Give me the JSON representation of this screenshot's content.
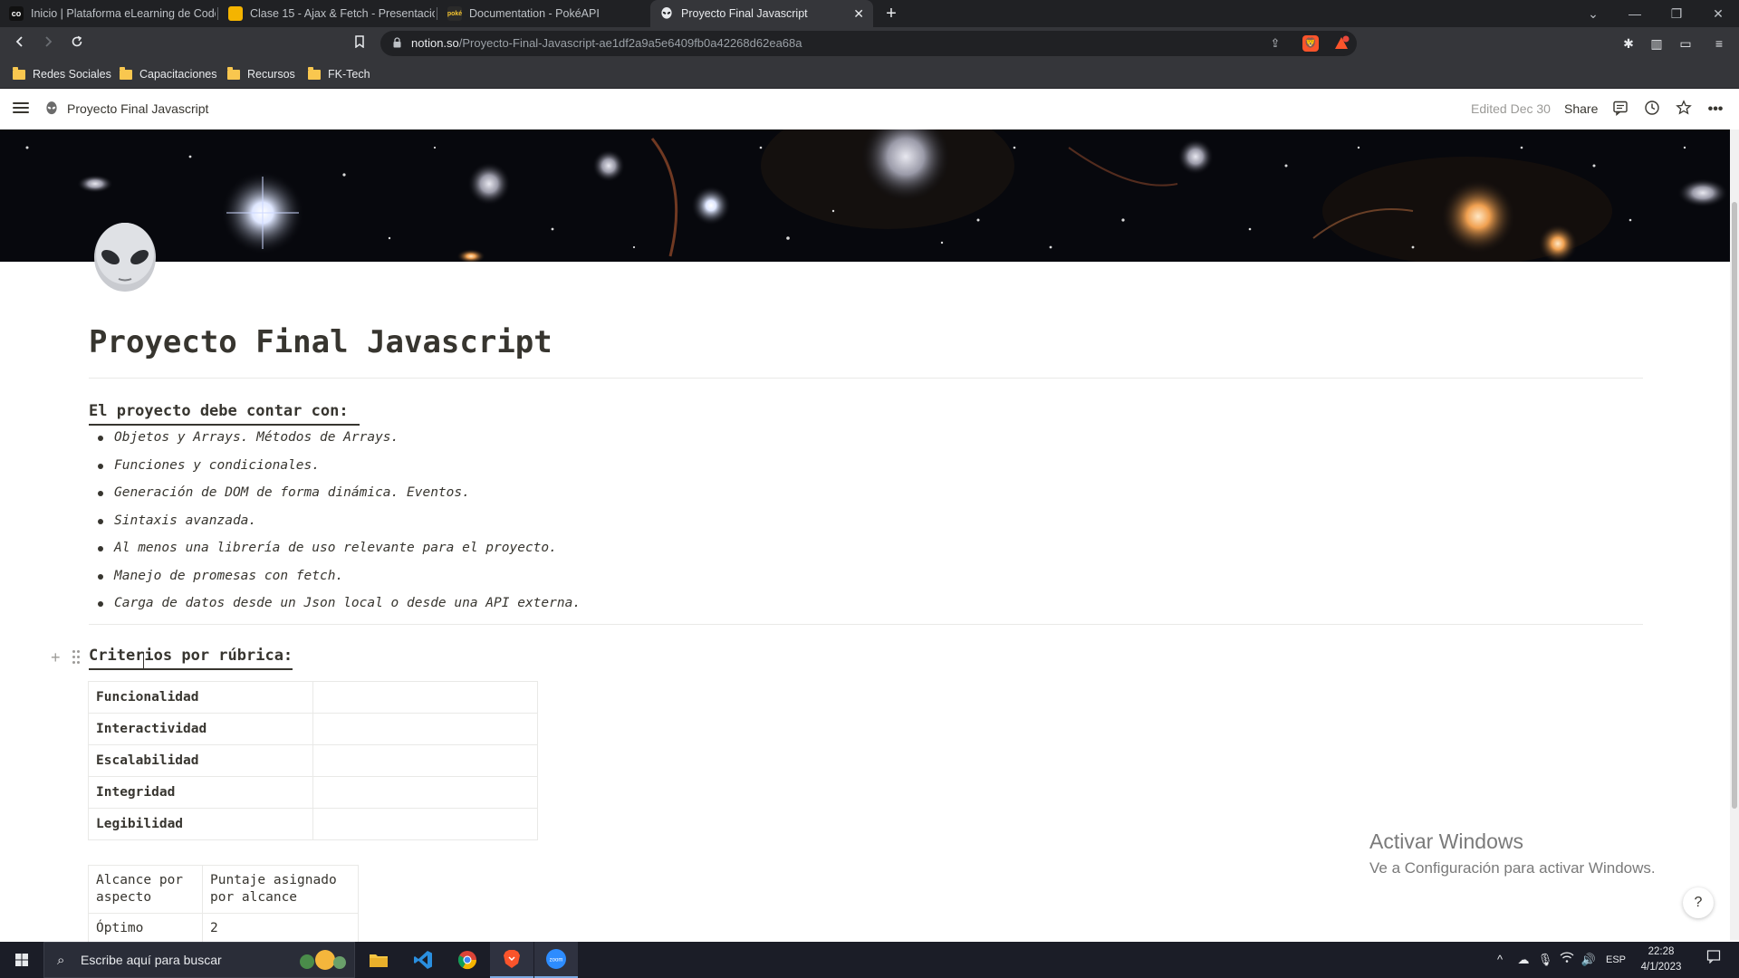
{
  "browser": {
    "tabs": [
      {
        "title": "Inicio | Plataforma eLearning de Coder",
        "favicon": "coder-icon",
        "color": "#111111"
      },
      {
        "title": "Clase 15 - Ajax & Fetch - Presentaciones",
        "favicon": "slides-icon",
        "color": "#f4b400"
      },
      {
        "title": "Documentation - PokéAPI",
        "favicon": "pokeapi-icon",
        "color": "#2a2a2a"
      },
      {
        "title": "Proyecto Final Javascript",
        "favicon": "notion-alien-icon",
        "color": "#35363a"
      }
    ],
    "url_host": "notion.so",
    "url_path": "/Proyecto-Final-Javascript-ae1df2a9a5e6409fb0a42268d62ea68a",
    "bookmarks": [
      "Redes Sociales",
      "Capacitaciones",
      "Recursos",
      "FK-Tech"
    ]
  },
  "notion": {
    "breadcrumb": "Proyecto Final Javascript",
    "edited": "Edited Dec 30",
    "share": "Share"
  },
  "page": {
    "title": "Proyecto Final Javascript",
    "requirements_heading": "El proyecto debe contar con:",
    "requirements": [
      "Objetos y Arrays. Métodos de Arrays.",
      "Funciones y condicionales.",
      "Generación de DOM de forma dinámica. Eventos.",
      "Sintaxis avanzada.",
      "Al menos una librería de uso relevante para el proyecto.",
      "Manejo de promesas con fetch.",
      "Carga de datos desde un Json local o desde una API externa."
    ],
    "criteria_heading": "Criterios por rúbrica:",
    "criteria": [
      "Funcionalidad",
      "Interactividad",
      "Escalabilidad",
      "Integridad",
      "Legibilidad"
    ],
    "scope_table": {
      "headers": [
        "Alcance por aspecto",
        "Puntaje asignado por alcance"
      ],
      "rows": [
        [
          "Óptimo",
          "2"
        ]
      ]
    }
  },
  "watermark": {
    "line1": "Activar Windows",
    "line2": "Ve a Configuración para activar Windows."
  },
  "help_label": "?",
  "taskbar": {
    "search_placeholder": "Escribe aquí para buscar",
    "language": "ESP",
    "time": "22:28",
    "date": "4/1/2023"
  }
}
